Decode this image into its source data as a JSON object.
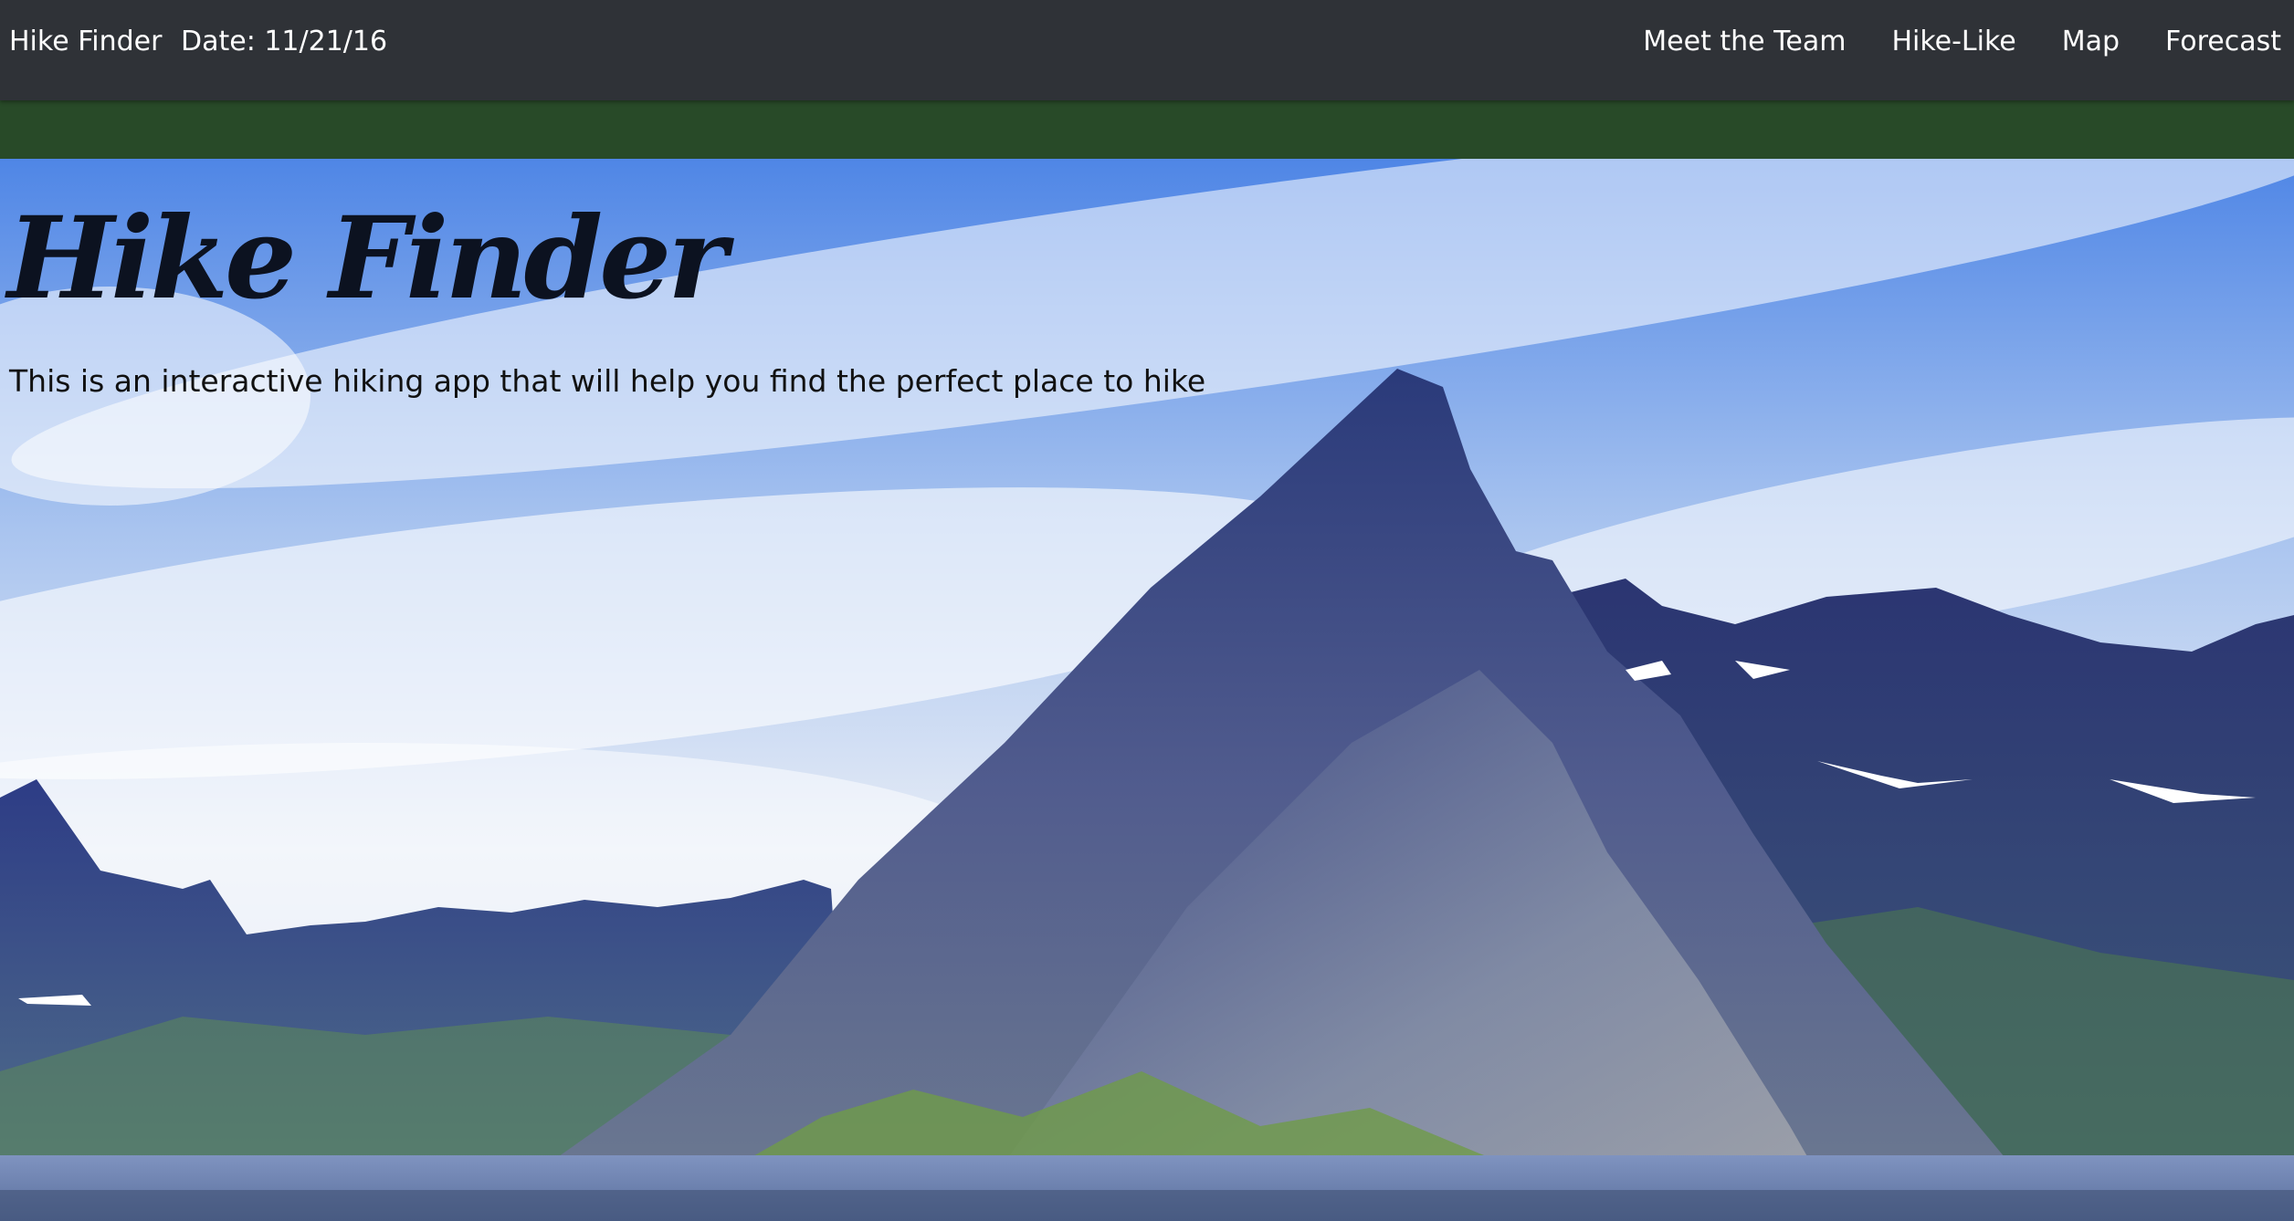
{
  "nav": {
    "brand": "Hike Finder",
    "date": "Date: 11/21/16",
    "links": [
      "Meet the Team",
      "Hike-Like",
      "Map",
      "Forecast"
    ]
  },
  "hero": {
    "title": "Hike Finder",
    "subtitle": "This is an interactive hiking app that will help you find the perfect place to hike"
  },
  "colors": {
    "navbar": "#2f3237",
    "band": "#284a28",
    "title": "#0c1220"
  }
}
